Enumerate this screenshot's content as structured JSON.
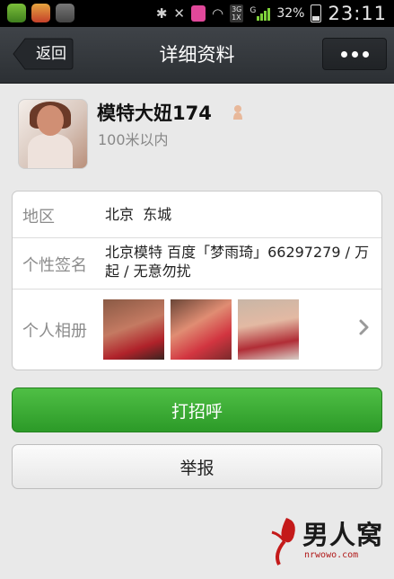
{
  "status_bar": {
    "network": "3G\n1X",
    "signal_label": "G",
    "battery": "32%",
    "time": "23:11"
  },
  "header": {
    "back_label": "返回",
    "title": "详细资料",
    "more_icon": "more-dots-icon"
  },
  "profile": {
    "nickname": "模特大妞174",
    "distance": "100米以内",
    "gender_icon": "female-icon"
  },
  "details": {
    "region_label": "地区",
    "region_value": "北京  东城",
    "signature_label": "个性签名",
    "signature_value": "北京模特 百度「梦雨琦」66297279 / 万起 / 无意勿扰",
    "album_label": "个人相册"
  },
  "actions": {
    "greet_label": "打招呼",
    "report_label": "举报"
  },
  "watermark": {
    "text": "男人窝",
    "sub": "nrwowo.com"
  },
  "colors": {
    "accent_green": "#37a832",
    "titlebar": "#353a3f",
    "background": "#e9e9e9"
  }
}
